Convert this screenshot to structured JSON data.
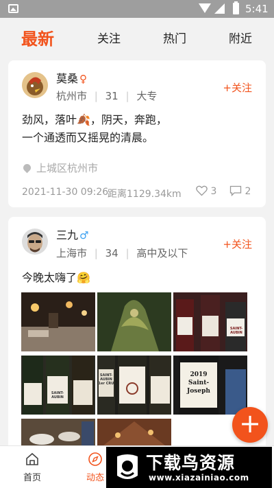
{
  "status_bar": {
    "time": "5:41",
    "icons": [
      "gallery-icon",
      "wifi-icon",
      "signal-icon",
      "battery-icon"
    ]
  },
  "tabs": [
    {
      "label": "最新",
      "active": true
    },
    {
      "label": "关注",
      "active": false
    },
    {
      "label": "热门",
      "active": false
    },
    {
      "label": "附近",
      "active": false
    }
  ],
  "posts": [
    {
      "username": "莫桑",
      "gender_icon": "female-icon",
      "gender_glyph": "♀",
      "city": "杭州市",
      "age": "31",
      "education": "大专",
      "sep": "|",
      "follow_label": "+关注",
      "text_lines": [
        "劲风，落叶🍂，阴天，奔跑，",
        "一个通透而又摇晃的清晨。"
      ],
      "location": "上城区杭州市",
      "datetime": "2021-11-30 09:26",
      "distance": "距离1129.34km",
      "likes": "3",
      "comments": "2"
    },
    {
      "username": "三九",
      "gender_icon": "male-icon",
      "gender_glyph": "♂",
      "city": "上海市",
      "age": "34",
      "education": "高中及以下",
      "sep": "|",
      "follow_label": "+关注",
      "text": "今晚太嗨了🤗",
      "photo_captions": [
        "SAINT-AUBIN",
        "SAINT-AUBIN 1er CRU",
        "2019 Saint-Joseph"
      ]
    }
  ],
  "bottom_nav": [
    {
      "label": "首页",
      "icon": "home-icon"
    },
    {
      "label": "动态",
      "icon": "compass-icon",
      "active": true
    }
  ],
  "watermark": {
    "title": "下载鸟资源",
    "url": "www.xiazainiao.com"
  },
  "colors": {
    "accent": "#f2531c",
    "background": "#f2f2f2"
  }
}
